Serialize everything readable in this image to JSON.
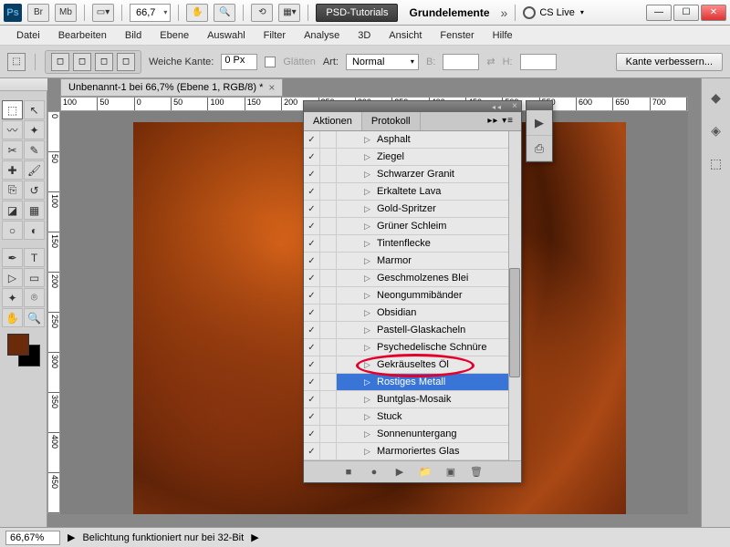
{
  "title": {
    "zoom_dd": "66,7",
    "psd_tut": "PSD-Tutorials",
    "workspace": "Grundelemente",
    "cslive": "CS Live"
  },
  "menu": [
    "Datei",
    "Bearbeiten",
    "Bild",
    "Ebene",
    "Auswahl",
    "Filter",
    "Analyse",
    "3D",
    "Ansicht",
    "Fenster",
    "Hilfe"
  ],
  "options": {
    "weiche_kante_label": "Weiche Kante:",
    "weiche_kante_val": "0 Px",
    "glaetten": "Glätten",
    "art_label": "Art:",
    "art_val": "Normal",
    "b_label": "B:",
    "h_label": "H:",
    "refine": "Kante verbessern..."
  },
  "doc_tab": "Unbenannt-1 bei 66,7% (Ebene 1, RGB/8) *",
  "ruler_h": [
    "100",
    "50",
    "0",
    "50",
    "100",
    "150",
    "200",
    "250",
    "300",
    "350",
    "400",
    "450",
    "500",
    "550",
    "600",
    "650",
    "700"
  ],
  "ruler_v": [
    "0",
    "50",
    "100",
    "150",
    "200",
    "250",
    "300",
    "350",
    "400",
    "450"
  ],
  "actions_panel": {
    "tab_aktionen": "Aktionen",
    "tab_protokoll": "Protokoll",
    "items": [
      {
        "n": "Asphalt",
        "cut": true
      },
      {
        "n": "Ziegel"
      },
      {
        "n": "Schwarzer Granit"
      },
      {
        "n": "Erkaltete Lava"
      },
      {
        "n": "Gold-Spritzer"
      },
      {
        "n": "Grüner Schleim"
      },
      {
        "n": "Tintenflecke"
      },
      {
        "n": "Marmor"
      },
      {
        "n": "Geschmolzenes Blei"
      },
      {
        "n": "Neongummibänder"
      },
      {
        "n": "Obsidian"
      },
      {
        "n": "Pastell-Glaskacheln"
      },
      {
        "n": "Psychedelische Schnüre"
      },
      {
        "n": "Gekräuseltes Öl"
      },
      {
        "n": "Rostiges Metall",
        "sel": true
      },
      {
        "n": "Buntglas-Mosaik"
      },
      {
        "n": "Stuck"
      },
      {
        "n": "Sonnenuntergang"
      },
      {
        "n": "Marmoriertes Glas"
      }
    ]
  },
  "status": {
    "zoom": "66,67%",
    "msg": "Belichtung funktioniert nur bei 32-Bit"
  }
}
